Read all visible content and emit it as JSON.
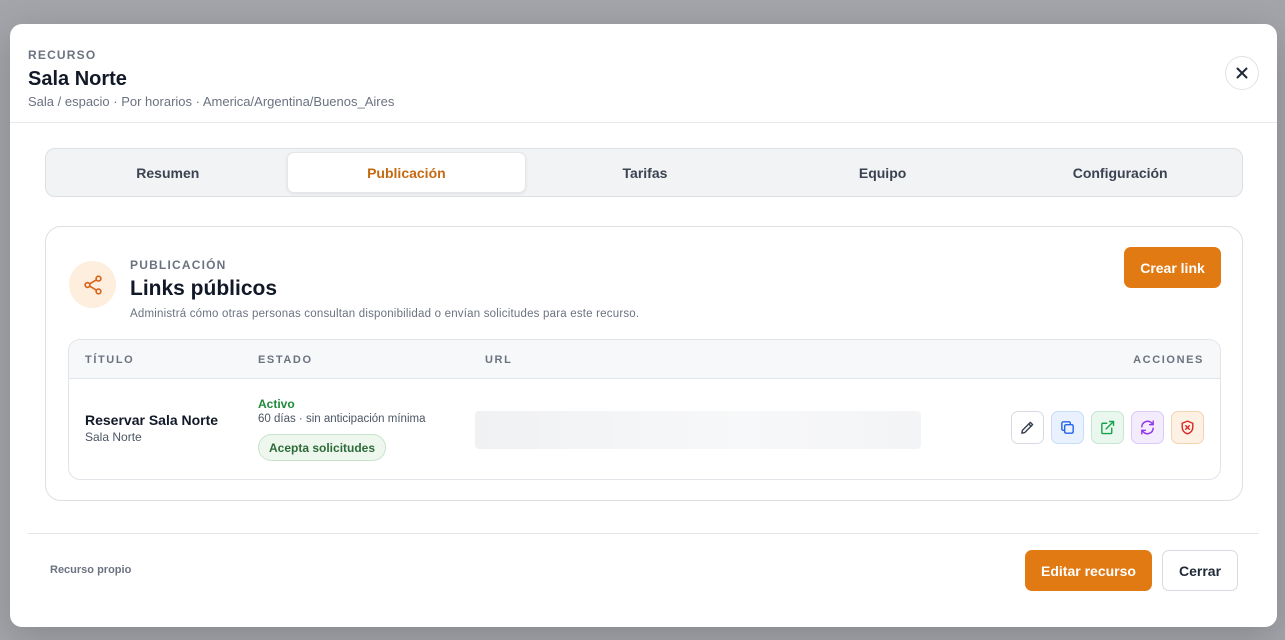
{
  "header": {
    "eyebrow": "RECURSO",
    "title": "Sala Norte",
    "subtitle": "Sala / espacio · Por horarios · America/Argentina/Buenos_Aires",
    "close_icon": "close-icon"
  },
  "tabs": [
    {
      "label": "Resumen",
      "active": false
    },
    {
      "label": "Publicación",
      "active": true
    },
    {
      "label": "Tarifas",
      "active": false
    },
    {
      "label": "Equipo",
      "active": false
    },
    {
      "label": "Configuración",
      "active": false
    }
  ],
  "card": {
    "icon": "share-icon",
    "eyebrow": "PUBLICACIÓN",
    "title": "Links públicos",
    "description": "Administrá cómo otras personas consultan disponibilidad o envían solicitudes para este recurso.",
    "create_button": "Crear link"
  },
  "table": {
    "columns": [
      "TÍTULO",
      "ESTADO",
      "URL",
      "ACCIONES"
    ],
    "rows": [
      {
        "title": "Reservar Sala Norte",
        "subtitle": "Sala Norte",
        "status": "Activo",
        "status_detail": "60 días · sin anticipación mínima",
        "badge": "Acepta solicitudes",
        "actions": [
          "edit-icon",
          "copy-icon",
          "external-link-icon",
          "refresh-icon",
          "shield-x-icon"
        ]
      }
    ]
  },
  "footer": {
    "note": "Recurso propio",
    "edit_button": "Editar recurso",
    "close_button": "Cerrar"
  },
  "colors": {
    "accent": "#e27a14",
    "active_tab_text": "#c56a12",
    "status_active": "#1f8a3a"
  }
}
